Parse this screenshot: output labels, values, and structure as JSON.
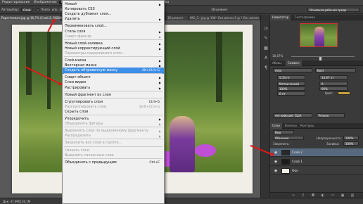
{
  "menubar": {
    "items": [
      "Редактирование",
      "Изображение",
      "Слои",
      "Выделение",
      "Фильтр",
      "3D",
      "Просмотр",
      "Окно",
      "Справка"
    ],
    "active_index": 2
  },
  "options": {
    "tool": "Автовыбор:",
    "target": "Слой",
    "show_controls": "Показ. упр. элем.",
    "mode_3d": "3D-режим:",
    "workspace": "Основная рабочая среда"
  },
  "doc_tabs": [
    "Paper-texture.jpg @ 16,7% (Слой 2, RGB/8#)",
    "3D-ремонт",
    "IMG_3...jpg @ 100% (RGB...",
    "Без имени-2 @ 100%...",
    "Без имени-..."
  ],
  "status": {
    "zoom_doc": "Док: 47,9М/116,1М"
  },
  "menu": {
    "items": [
      {
        "label": "Новый",
        "arrow": "▶"
      },
      {
        "label": "Копировать CSS"
      },
      {
        "label": "Создать дубликат слоя..."
      },
      {
        "label": "Удалить",
        "arrow": "▶"
      },
      {
        "sep": true
      },
      {
        "label": "Переименовать слой..."
      },
      {
        "label": "Стиль слоя",
        "arrow": "▶"
      },
      {
        "label": "Смарт-фильтр",
        "arrow": "▶",
        "disabled": true
      },
      {
        "sep": true
      },
      {
        "label": "Новый слой-заливка",
        "arrow": "▶"
      },
      {
        "label": "Новый корректирующий слой",
        "arrow": "▶"
      },
      {
        "label": "Параметры содержимого слоя...",
        "disabled": true
      },
      {
        "sep": true
      },
      {
        "label": "Слой-маска",
        "arrow": "▶"
      },
      {
        "label": "Векторная маска",
        "arrow": "▶"
      },
      {
        "label": "Создать обтравочную маску",
        "shortcut": "Alt+Ctrl+G",
        "highlight": true
      },
      {
        "sep": true
      },
      {
        "label": "Смарт-объект",
        "arrow": "▶"
      },
      {
        "label": "Слои видео",
        "arrow": "▶"
      },
      {
        "label": "Растрировать",
        "arrow": "▶"
      },
      {
        "sep": true
      },
      {
        "label": "Новый фрагмент из слоя"
      },
      {
        "sep": true
      },
      {
        "label": "Сгруппировать слои",
        "shortcut": "Ctrl+G"
      },
      {
        "label": "Разгруппировать слои",
        "shortcut": "Shift+Ctrl+G",
        "disabled": true
      },
      {
        "label": "Скрыть слои"
      },
      {
        "sep": true
      },
      {
        "label": "Упорядочить",
        "arrow": "▶"
      },
      {
        "label": "Объединить фигуры",
        "arrow": "▶",
        "disabled": true
      },
      {
        "sep": true
      },
      {
        "label": "Выровнять слои по выделенному фрагменту",
        "arrow": "▶",
        "disabled": true
      },
      {
        "label": "Распределить",
        "arrow": "▶",
        "disabled": true
      },
      {
        "sep": true
      },
      {
        "label": "Закрепить все слои в группе...",
        "disabled": true
      },
      {
        "sep": true
      },
      {
        "label": "Связать слои",
        "disabled": true
      },
      {
        "label": "Выделить связанные слои",
        "disabled": true
      },
      {
        "sep": true
      },
      {
        "label": "Объединить с предыдущим",
        "shortcut": "Ctrl+E"
      }
    ]
  },
  "right_panel": {
    "nav_tabs": [
      "Навигатор",
      "Гистограмма"
    ],
    "zoom": "16,67%",
    "char_tabs": [
      "Абзац",
      "Символ"
    ],
    "font": "Arial",
    "style": "Bold",
    "size": "5,33 пт",
    "leading": "14,67 пт",
    "kerning": "Метрический",
    "tracking": "0",
    "scale_v": "100%",
    "scale_h": "96%",
    "baseline": "0 пт",
    "color_label": "Цвет:",
    "lang": "Английский: США",
    "aa": "Резкое",
    "layers_tabs": [
      "Слои",
      "Каналы",
      "Контуры"
    ],
    "filter": "Вид",
    "blend": "Обычные",
    "opacity_label": "Непрозрачность:",
    "opacity": "100%",
    "lock_label": "Закрепить:",
    "fill_label": "Заливка:",
    "fill": "100%",
    "layers": [
      {
        "name": "Слой 2",
        "selected": true
      },
      {
        "name": "Слой 1",
        "selected": false
      },
      {
        "name": "Фон",
        "selected": false
      }
    ]
  },
  "colors": {
    "accent": "#3d8ee8",
    "arrow": "#e01818",
    "swatch": "#c8a23c"
  }
}
